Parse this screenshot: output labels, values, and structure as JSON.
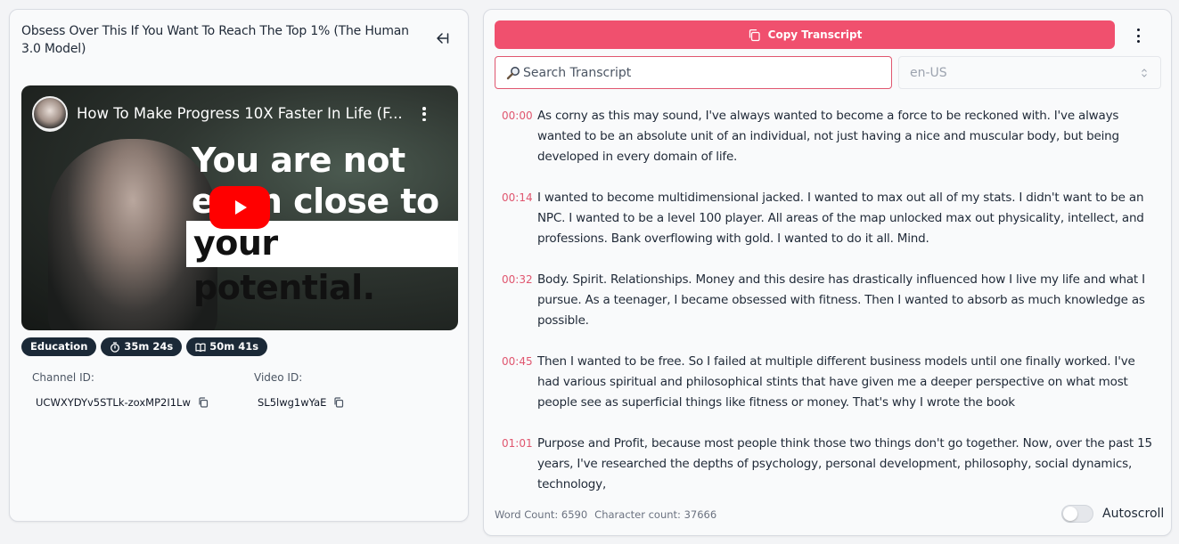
{
  "video": {
    "title": "Obsess Over This If You Want To Reach The Top 1% (The Human 3.0 Model)",
    "thumbnail_title": "How To Make Progress 10X Faster In Life (F...",
    "thumbnail_line1": "You are not",
    "thumbnail_line2": "even close to",
    "thumbnail_line3": "your potential.",
    "badges": {
      "category": "Education",
      "duration": "35m 24s",
      "read_time": "50m 41s"
    },
    "channel_label": "Channel ID:",
    "channel_id": "UCWXYDYv5STLk-zoxMP2I1Lw",
    "video_label": "Video ID:",
    "video_id": "SL5lwg1wYaE"
  },
  "transcript_panel": {
    "copy_label": "Copy Transcript",
    "search_placeholder": "Search Transcript",
    "language": "en-US",
    "segments": [
      {
        "time": "00:00",
        "text": "As corny as this may sound, I've always wanted to become a force to be reckoned with. I've always wanted to be an absolute unit of an individual, not just having a nice and muscular body, but being developed in every domain of life."
      },
      {
        "time": "00:14",
        "text": "I wanted to become multidimensional jacked. I wanted to max out all of my stats. I didn't want to be an NPC. I wanted to be a level 100 player. All areas of the map unlocked max out physicality, intellect, and professions. Bank overflowing with gold. I wanted to do it all. Mind."
      },
      {
        "time": "00:32",
        "text": "Body. Spirit. Relationships. Money and this desire has drastically influenced how I live my life and what I pursue. As a teenager, I became obsessed with fitness. Then I wanted to absorb as much knowledge as possible."
      },
      {
        "time": "00:45",
        "text": "Then I wanted to be free. So I failed at multiple different business models until one finally worked. I've had various spiritual and philosophical stints that have given me a deeper perspective on what most people see as superficial things like fitness or money. That's why I wrote the book"
      },
      {
        "time": "01:01",
        "text": "Purpose and Profit, because most people think those two things don't go together. Now, over the past 15 years, I've researched the depths of psychology, personal development, philosophy, social dynamics, technology,"
      }
    ],
    "word_count": "Word Count: 6590",
    "char_count": "Character count: 37666",
    "autoscroll_label": "Autoscroll",
    "autoscroll_on": false
  },
  "colors": {
    "accent": "#f0506e",
    "badge_bg": "#1b2937",
    "youtube_red": "#ff0000"
  },
  "icons": [
    "collapse-left-icon",
    "youtube-play-icon",
    "more-vertical-icon",
    "timer-icon",
    "book-icon",
    "copy-icon",
    "search-icon",
    "chevron-updown-icon"
  ]
}
